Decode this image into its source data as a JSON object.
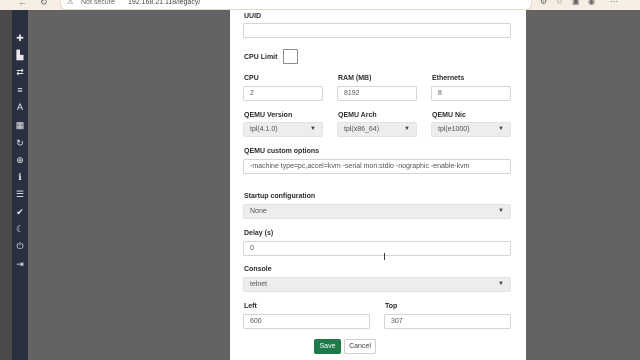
{
  "browser": {
    "security_text": "Not secure",
    "url": "192.168.21.118/legacy/"
  },
  "sidebar": {
    "icons": [
      "plus-icon",
      "server-icon",
      "swap-icon",
      "align-left-icon",
      "text-icon",
      "grid-icon",
      "refresh-icon",
      "zoom-in-icon",
      "info-icon",
      "list-icon",
      "check-circle-icon",
      "moon-icon",
      "power-icon",
      "logout-icon"
    ]
  },
  "form": {
    "uuid": {
      "label": "UUID",
      "value": ""
    },
    "cpu_limit": {
      "label": "CPU Limit",
      "checked": false
    },
    "cpu": {
      "label": "CPU",
      "value": "2"
    },
    "ram": {
      "label": "RAM (MB)",
      "value": "8192"
    },
    "ethernets": {
      "label": "Ethernets",
      "value": "8"
    },
    "qemu_version": {
      "label": "QEMU Version",
      "value": "tpl(4.1.0)"
    },
    "qemu_arch": {
      "label": "QEMU Arch",
      "value": "tpl(x86_64)"
    },
    "qemu_nic": {
      "label": "QEMU Nic",
      "value": "tpl(e1000)"
    },
    "qemu_options": {
      "label": "QEMU custom options",
      "value": "-machine type=pc,accel=kvm -serial mon:stdio -nographic -enable-kvm"
    },
    "startup_config": {
      "label": "Startup configuration",
      "value": "None"
    },
    "delay": {
      "label": "Delay (s)",
      "value": "0"
    },
    "console": {
      "label": "Console",
      "value": "telnet"
    },
    "left": {
      "label": "Left",
      "value": "600"
    },
    "top": {
      "label": "Top",
      "value": "307"
    }
  },
  "buttons": {
    "save": "Save",
    "cancel": "Cancel"
  }
}
